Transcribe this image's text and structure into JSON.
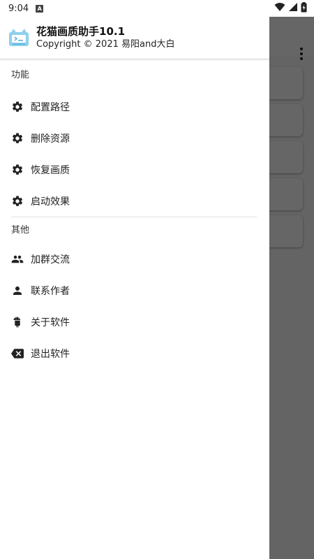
{
  "status_bar": {
    "time": "9:04",
    "notification_glyph": "A"
  },
  "drawer": {
    "header": {
      "title": "花猫画质助手10.1",
      "copyright": "Copyright © 2021 易阳and大白"
    },
    "sections": [
      {
        "title": "功能",
        "items": [
          {
            "label": "配置路径",
            "icon": "gear-icon"
          },
          {
            "label": "删除资源",
            "icon": "gear-icon"
          },
          {
            "label": "恢复画质",
            "icon": "gear-icon"
          },
          {
            "label": "启动效果",
            "icon": "gear-icon"
          }
        ]
      },
      {
        "title": "其他",
        "items": [
          {
            "label": "加群交流",
            "icon": "group-icon"
          },
          {
            "label": "联系作者",
            "icon": "person-icon"
          },
          {
            "label": "关于软件",
            "icon": "android-icon"
          },
          {
            "label": "退出软件",
            "icon": "backspace-icon"
          }
        ]
      }
    ]
  },
  "colors": {
    "scrim": "#000000",
    "icon": "#222222",
    "logo": "#7ec3e6"
  }
}
